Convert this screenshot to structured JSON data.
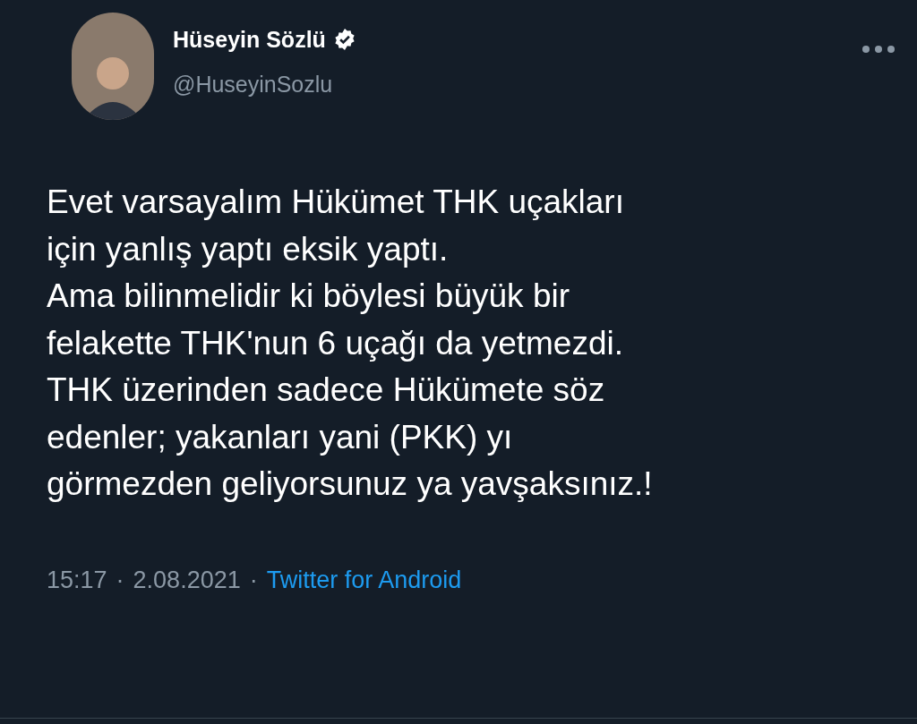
{
  "author": {
    "name": "Hüseyin Sözlü",
    "verified": true,
    "handle": "@HuseyinSozlu"
  },
  "tweet": {
    "lines": [
      "Evet varsayalım Hükümet THK uçakları",
      "için yanlış yaptı eksik yaptı.",
      "Ama bilinmelidir ki böylesi büyük bir",
      "felakette THK'nun 6 uçağı da yetmezdi.",
      "THK üzerinden sadece Hükümete söz",
      "edenler; yakanları yani (PKK) yı",
      "görmezden geliyorsunuz ya yavşaksınız.!"
    ]
  },
  "meta": {
    "time": "15:17",
    "separator_1": "·",
    "date": "2.08.2021",
    "separator_2": "·",
    "source": "Twitter for Android"
  }
}
